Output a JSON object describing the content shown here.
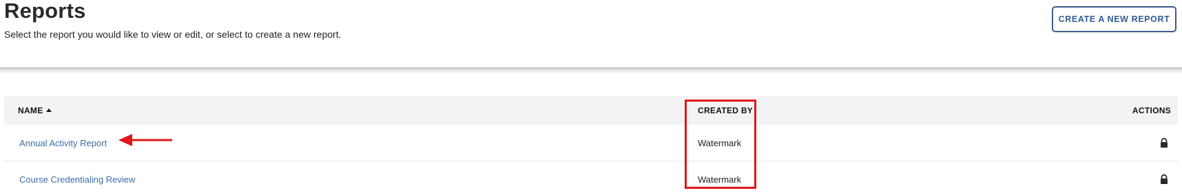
{
  "header": {
    "title": "Reports",
    "subtitle": "Select the report you would like to view or edit, or select to create a new report.",
    "create_button_label": "CREATE A NEW REPORT"
  },
  "table": {
    "columns": {
      "name": "NAME",
      "created_by": "CREATED BY",
      "actions": "ACTIONS"
    },
    "sort": {
      "column": "name",
      "direction": "ascending",
      "icon": "sort-ascending-icon"
    },
    "rows": [
      {
        "name": "Annual Activity Report",
        "created_by": "Watermark",
        "action_icon": "lock-icon"
      },
      {
        "name": "Course Credentialing Review",
        "created_by": "Watermark",
        "action_icon": "lock-icon"
      }
    ]
  },
  "colors": {
    "link": "#3a6ea5",
    "button_border": "#3d5a8a",
    "button_text": "#2f5d94",
    "header_row_bg": "#f3f3f5",
    "annotation": "#e0161b"
  },
  "annotations": {
    "highlight": "created-by column",
    "arrow_target": "Annual Activity Report"
  }
}
